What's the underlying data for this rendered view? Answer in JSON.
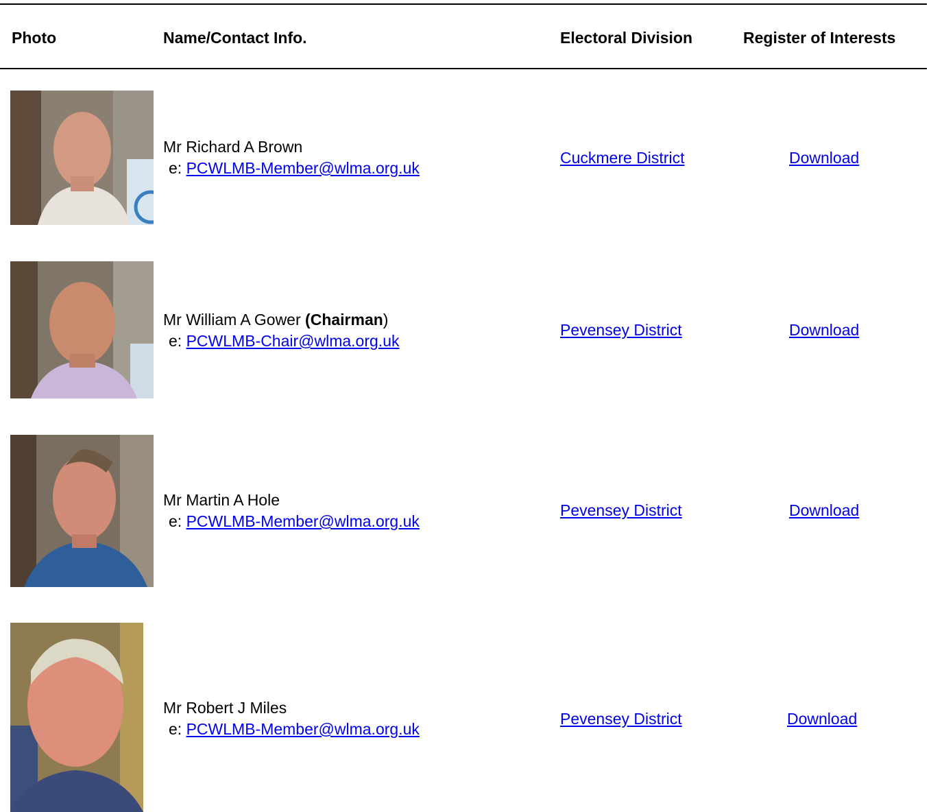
{
  "table": {
    "headers": {
      "photo": "Photo",
      "name": "Name/Contact Info.",
      "division": "Electoral Division",
      "register": "Register of Interests"
    },
    "email_prefix": "e:",
    "members": [
      {
        "name": "Mr Richard A Brown",
        "email": "PCWLMB-Member@wlma.org.uk",
        "division": "Cuckmere District",
        "register": "Download"
      },
      {
        "name": "Mr William A Gower",
        "role_open": "(",
        "role": "Chairman",
        "role_close": ")",
        "email": "PCWLMB-Chair@wlma.org.uk",
        "division": "Pevensey District",
        "register": "Download"
      },
      {
        "name": "Mr Martin A Hole",
        "email": "PCWLMB-Member@wlma.org.uk",
        "division": "Pevensey District",
        "register": "Download"
      },
      {
        "name": "Mr Robert J Miles",
        "email": "PCWLMB-Member@wlma.org.uk",
        "division": "Pevensey District",
        "register": "Download"
      }
    ]
  },
  "colors": {
    "link": "#0000ee",
    "rule": "#000000"
  }
}
